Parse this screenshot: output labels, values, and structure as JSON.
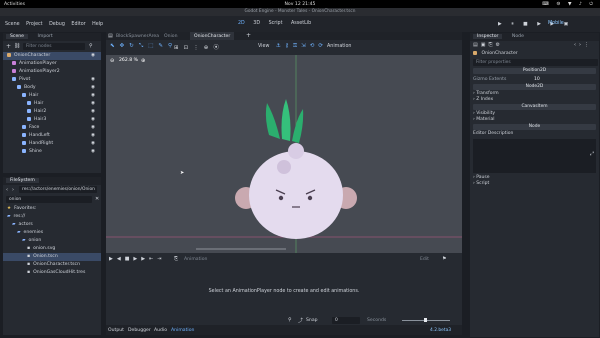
{
  "topbar": {
    "activities": "Activities",
    "clock": "Nov 12  21:45",
    "status_icons": "⌨ ⚙ ▼ ♪ ⏻"
  },
  "window_title": "Godot Engine - Monster Tales - OnionCharacter.tscn",
  "menu": [
    "Scene",
    "Project",
    "Debug",
    "Editor",
    "Help"
  ],
  "workspaces": [
    "2D",
    "3D",
    "Script",
    "AssetLib"
  ],
  "play_controls": "▶ ⏸ ■ ▶ ▶ ▣",
  "renderer": "Mobile",
  "scene_panel": {
    "tabs": [
      "Scene",
      "Import"
    ],
    "filter_placeholder": "Filter nodes",
    "tree": [
      {
        "label": "OnionCharacter",
        "indent": 0,
        "color": "#d9a96b",
        "eye": true,
        "selected": true
      },
      {
        "label": "AnimationPlayer",
        "indent": 1,
        "color": "#c980d8",
        "eye": false
      },
      {
        "label": "AnimationPlayer2",
        "indent": 1,
        "color": "#c980d8",
        "eye": false
      },
      {
        "label": "Pivot",
        "indent": 1,
        "color": "#8ab4ff",
        "eye": true
      },
      {
        "label": "Body",
        "indent": 2,
        "color": "#8ab4ff",
        "eye": true
      },
      {
        "label": "Hair",
        "indent": 3,
        "color": "#8ab4ff",
        "eye": true
      },
      {
        "label": "Hair",
        "indent": 4,
        "color": "#8ab4ff",
        "eye": true
      },
      {
        "label": "Hair2",
        "indent": 4,
        "color": "#8ab4ff",
        "eye": true
      },
      {
        "label": "Hair3",
        "indent": 4,
        "color": "#8ab4ff",
        "eye": true
      },
      {
        "label": "Face",
        "indent": 3,
        "color": "#8ab4ff",
        "eye": true
      },
      {
        "label": "HandLeft",
        "indent": 3,
        "color": "#8ab4ff",
        "eye": true
      },
      {
        "label": "HandRight",
        "indent": 3,
        "color": "#8ab4ff",
        "eye": true
      },
      {
        "label": "Shine",
        "indent": 3,
        "color": "#8ab4ff",
        "eye": true
      }
    ]
  },
  "filesystem": {
    "title": "FileSystem",
    "path": "res://actors/enemies/onion/Onion",
    "search_value": "onion",
    "tree": [
      {
        "label": "Favorites:",
        "indent": 0,
        "kind": "star"
      },
      {
        "label": "res://",
        "indent": 0,
        "kind": "folder"
      },
      {
        "label": "actors",
        "indent": 1,
        "kind": "folder"
      },
      {
        "label": "enemies",
        "indent": 2,
        "kind": "folder"
      },
      {
        "label": "onion",
        "indent": 3,
        "kind": "folder"
      },
      {
        "label": "onion.svg",
        "indent": 4,
        "kind": "file"
      },
      {
        "label": "Onion.tscn",
        "indent": 4,
        "kind": "file",
        "selected": true
      },
      {
        "label": "OnionCharacter.tscn",
        "indent": 4,
        "kind": "file"
      },
      {
        "label": "OnionGasCloudHit.tres",
        "indent": 4,
        "kind": "file"
      }
    ]
  },
  "editor_tabs": [
    "BlockSpawnerArea",
    "Onion",
    "OnionCharacter"
  ],
  "viewport_toolbar": {
    "view_label": "View",
    "animation_label": "Animation",
    "zoom": "262.8 %"
  },
  "bottom_panel": {
    "animation_label": "Animation",
    "edit_label": "Edit",
    "message": "Select an AnimationPlayer node to create and edit animations.",
    "snap_label": "Snap",
    "snap_value": "0",
    "seconds_label": "Seconds",
    "tabs": [
      "Output",
      "Debugger",
      "Audio",
      "Animation"
    ],
    "version": "4.2.beta3"
  },
  "inspector": {
    "tabs": [
      "Inspector",
      "Node"
    ],
    "node_name": "OnionCharacter",
    "filter_placeholder": "Filter properties",
    "position_btn": "Position2D",
    "gizmo_label": "Gizmo Extents",
    "gizmo_value": "10",
    "node2d_btn": "Node2D",
    "transform": "Transform",
    "zindex": "Z Index",
    "canvasitem_btn": "CanvasItem",
    "visibility": "Visibility",
    "material": "Material",
    "node_btn": "Node",
    "editor_desc": "Editor Description",
    "process": "Pause",
    "script": "Script"
  }
}
